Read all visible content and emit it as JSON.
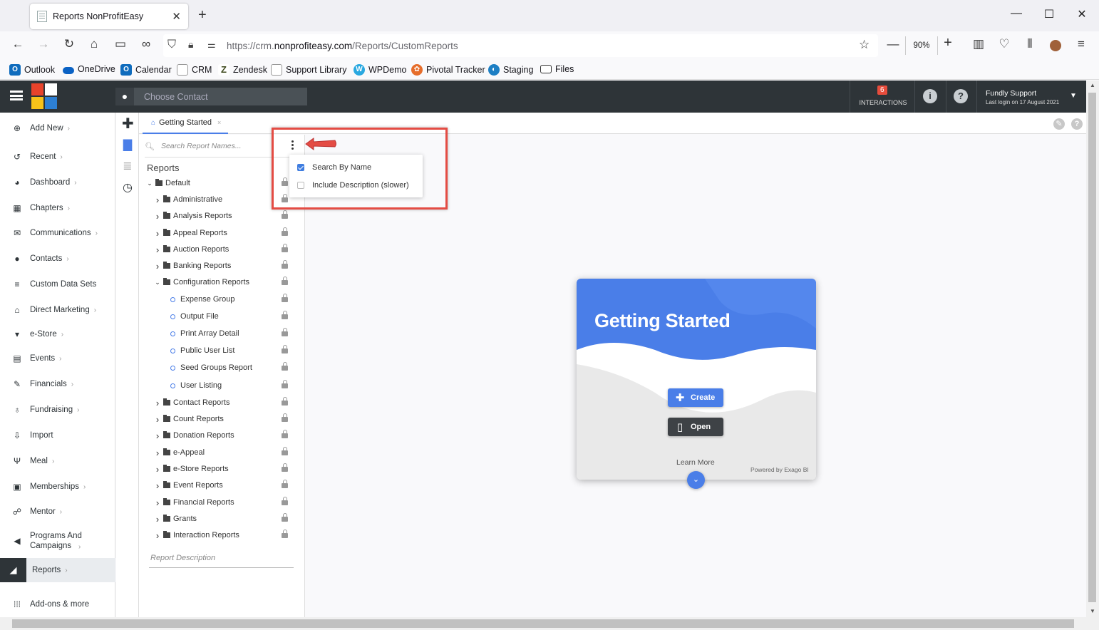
{
  "browser": {
    "tab_title": "Reports NonProfitEasy",
    "tab_close": "✕",
    "new_tab": "+",
    "url_prefix": "https://crm.",
    "url_domain": "nonprofiteasy.com",
    "url_path": "/Reports/CustomReports",
    "zoom": "90%",
    "zoom_minus": "—",
    "zoom_plus": "+",
    "window_controls": [
      "—",
      "☐",
      "✕"
    ],
    "bookmarks": [
      {
        "label": "Outlook",
        "icon": "outlook-icon",
        "color": "#0f6cbd"
      },
      {
        "label": "OneDrive",
        "icon": "onedrive-icon",
        "color": "#0a62c4"
      },
      {
        "label": "Calendar",
        "icon": "outlook-icon",
        "color": "#0f6cbd"
      },
      {
        "label": "CRM",
        "icon": "page-icon",
        "color": "#888888"
      },
      {
        "label": "Zendesk",
        "icon": "zendesk-icon",
        "color": "#3f4a1f"
      },
      {
        "label": "Support Library",
        "icon": "page-icon",
        "color": "#888888"
      },
      {
        "label": "WPDemo",
        "icon": "wp-icon",
        "color": "#29a8e0"
      },
      {
        "label": "Pivotal Tracker",
        "icon": "pivotal-icon",
        "color": "#e66d2b"
      },
      {
        "label": "Staging",
        "icon": "staging-icon",
        "color": "#1d7fc4"
      },
      {
        "label": "Files",
        "icon": "folder-icon",
        "color": "#333333"
      }
    ]
  },
  "header": {
    "contact_placeholder": "Choose Contact",
    "interactions_count": "6",
    "interactions_label": "INTERACTIONS",
    "info_icon": "i",
    "help_icon": "?",
    "user_name": "Fundly Support",
    "last_login": "Last login on 17 August 2021",
    "logo_colors": [
      "#e8432b",
      "#ffffff",
      "#f7c31a",
      "#2d7fd3"
    ]
  },
  "sidebar": {
    "items": [
      {
        "label": "Add New",
        "icon": "plus-circle-icon",
        "glyph": "⊕",
        "chev": true
      },
      {
        "label": "Recent",
        "icon": "history-icon",
        "glyph": "↺",
        "chev": true
      },
      {
        "label": "Dashboard",
        "icon": "dashboard-icon",
        "glyph": "◕",
        "chev": true
      },
      {
        "label": "Chapters",
        "icon": "grid-icon",
        "glyph": "▦",
        "chev": true
      },
      {
        "label": "Communications",
        "icon": "envelope-icon",
        "glyph": "✉",
        "chev": true
      },
      {
        "label": "Contacts",
        "icon": "user-icon",
        "glyph": "●",
        "chev": true
      },
      {
        "label": "Custom Data Sets",
        "icon": "database-icon",
        "glyph": "≡",
        "chev": false
      },
      {
        "label": "Direct Marketing",
        "icon": "bank-icon",
        "glyph": "⌂",
        "chev": true
      },
      {
        "label": "e-Store",
        "icon": "cart-icon",
        "glyph": "▾",
        "chev": true
      },
      {
        "label": "Events",
        "icon": "calendar-icon",
        "glyph": "▤",
        "chev": true
      },
      {
        "label": "Financials",
        "icon": "money-icon",
        "glyph": "✎",
        "chev": true
      },
      {
        "label": "Fundraising",
        "icon": "moneybag-icon",
        "glyph": "♁",
        "chev": true
      },
      {
        "label": "Import",
        "icon": "download-icon",
        "glyph": "⇩",
        "chev": false
      },
      {
        "label": "Meal",
        "icon": "cutlery-icon",
        "glyph": "Ψ",
        "chev": true
      },
      {
        "label": "Memberships",
        "icon": "id-card-icon",
        "glyph": "▣",
        "chev": true
      },
      {
        "label": "Mentor",
        "icon": "mentor-icon",
        "glyph": "☍",
        "chev": true
      },
      {
        "label": "Programs And Campaigns",
        "icon": "megaphone-icon",
        "glyph": "◀",
        "chev": true
      },
      {
        "label": "Reports",
        "icon": "area-chart-icon",
        "glyph": "◢",
        "chev": true
      },
      {
        "label": "Add-ons & more",
        "icon": "apps-icon",
        "glyph": "⁞⁞⁞",
        "chev": false
      }
    ]
  },
  "content": {
    "tab_label": "Getting Started",
    "tab_close": "×",
    "search_placeholder": "Search Report Names...",
    "tree_title": "Reports",
    "tree": [
      {
        "label": "Default",
        "type": "folder",
        "open": true,
        "level": 0
      },
      {
        "label": "Administrative",
        "type": "folder",
        "open": false,
        "level": 1
      },
      {
        "label": "Analysis Reports",
        "type": "folder",
        "open": false,
        "level": 1
      },
      {
        "label": "Appeal Reports",
        "type": "folder",
        "open": false,
        "level": 1
      },
      {
        "label": "Auction Reports",
        "type": "folder",
        "open": false,
        "level": 1
      },
      {
        "label": "Banking Reports",
        "type": "folder",
        "open": false,
        "level": 1
      },
      {
        "label": "Configuration Reports",
        "type": "folder",
        "open": true,
        "level": 1
      },
      {
        "label": "Expense Group",
        "type": "report",
        "level": 2
      },
      {
        "label": "Output File",
        "type": "report",
        "level": 2
      },
      {
        "label": "Print Array Detail",
        "type": "report",
        "level": 2
      },
      {
        "label": "Public User List",
        "type": "report",
        "level": 2
      },
      {
        "label": "Seed Groups Report",
        "type": "report",
        "level": 2
      },
      {
        "label": "User Listing",
        "type": "report",
        "level": 2
      },
      {
        "label": "Contact Reports",
        "type": "folder",
        "open": false,
        "level": 1
      },
      {
        "label": "Count Reports",
        "type": "folder",
        "open": false,
        "level": 1
      },
      {
        "label": "Donation Reports",
        "type": "folder",
        "open": false,
        "level": 1
      },
      {
        "label": "e-Appeal",
        "type": "folder",
        "open": false,
        "level": 1
      },
      {
        "label": "e-Store Reports",
        "type": "folder",
        "open": false,
        "level": 1
      },
      {
        "label": "Event Reports",
        "type": "folder",
        "open": false,
        "level": 1
      },
      {
        "label": "Financial Reports",
        "type": "folder",
        "open": false,
        "level": 1
      },
      {
        "label": "Grants",
        "type": "folder",
        "open": false,
        "level": 1
      },
      {
        "label": "Interaction Reports",
        "type": "folder",
        "open": false,
        "level": 1
      }
    ],
    "report_description_placeholder": "Report Description",
    "search_options": [
      {
        "label": "Search By Name",
        "checked": true
      },
      {
        "label": "Include Description (slower)",
        "checked": false
      }
    ]
  },
  "card": {
    "title": "Getting Started",
    "create_label": "Create",
    "open_label": "Open",
    "learn_more": "Learn More",
    "powered_by": "Powered by Exago BI",
    "accent": "#4a7ee8"
  }
}
